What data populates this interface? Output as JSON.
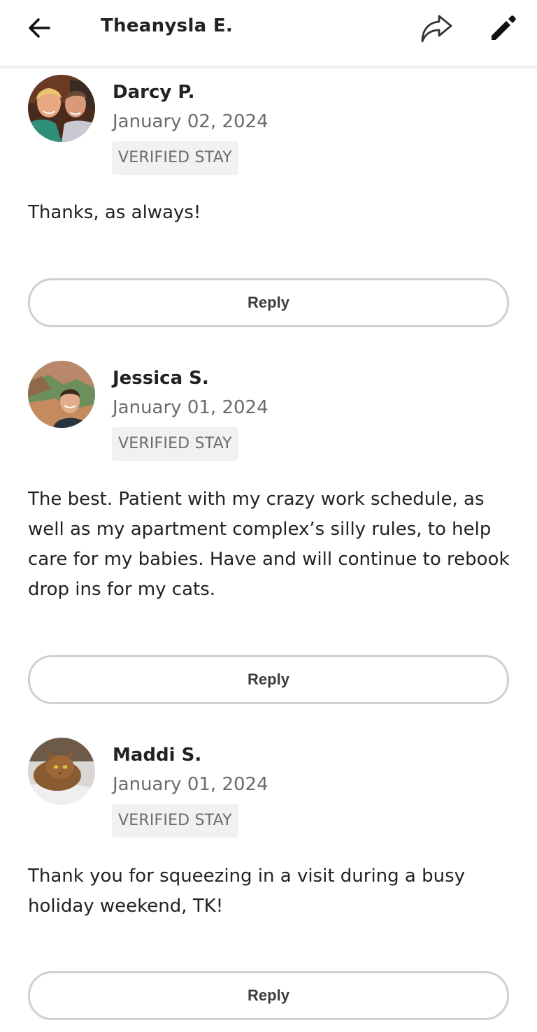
{
  "header": {
    "title": "Theanysla E.",
    "back_icon": "arrow-left-icon",
    "share_icon": "share-icon",
    "edit_icon": "pencil-icon"
  },
  "reviews": [
    {
      "name": "Darcy P.",
      "date": "January 02, 2024",
      "badge": "VERIFIED STAY",
      "text": "Thanks, as always!",
      "reply_label": "Reply"
    },
    {
      "name": "Jessica S.",
      "date": "January 01, 2024",
      "badge": "VERIFIED STAY",
      "text": "The best. Patient with my crazy work schedule, as well as my apartment complex’s silly rules, to help care for my babies. Have and will continue to rebook drop ins for my cats.",
      "reply_label": "Reply"
    },
    {
      "name": "Maddi S.",
      "date": "January 01, 2024",
      "badge": "VERIFIED STAY",
      "text": "Thank you for squeezing in a visit during a busy holiday weekend, TK!",
      "reply_label": "Reply"
    }
  ],
  "colors": {
    "text": "#222222",
    "muted": "#6b6b6b",
    "badge_bg": "#f1f1f3",
    "button_border": "#cdd0d5"
  }
}
